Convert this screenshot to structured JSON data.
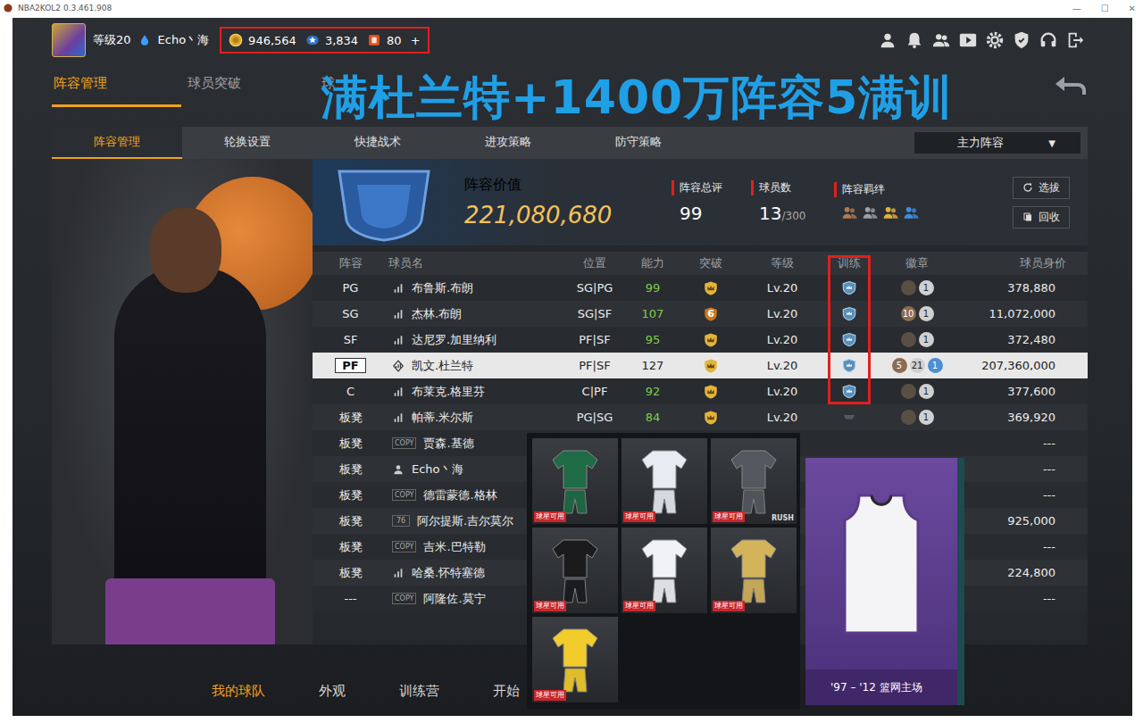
{
  "window": {
    "title": "NBA2KOL2 0.3.461.908",
    "controls": [
      "—",
      "☐",
      "✕"
    ]
  },
  "profile": {
    "level": "等级20",
    "name": "Echo丶海"
  },
  "currency": {
    "boxed": true,
    "items": [
      {
        "kind": "coin",
        "value": "946,564"
      },
      {
        "kind": "star",
        "value": "3,834"
      },
      {
        "kind": "ticket",
        "value": "80"
      }
    ],
    "add": "+"
  },
  "top_tabs": [
    {
      "label": "阵容管理",
      "selected": true
    },
    {
      "label": "球员突破",
      "selected": false
    },
    {
      "label": "球",
      "selected": false
    }
  ],
  "banner": "满杜兰特+1400万阵容5满训",
  "sub_tabs": [
    {
      "label": "阵容管理",
      "selected": true
    },
    {
      "label": "轮换设置",
      "selected": false
    },
    {
      "label": "快捷战术",
      "selected": false
    },
    {
      "label": "进攻策略",
      "selected": false
    },
    {
      "label": "防守策略",
      "selected": false
    }
  ],
  "lineup_select": {
    "value": "主力阵容",
    "arrow": "▼"
  },
  "summary": {
    "value_label": "阵容价值",
    "value": "221,080,680",
    "rating_label": "阵容总评",
    "rating": "99",
    "count_label": "球员数",
    "count": "13",
    "count_max": "/300",
    "bond_label": "阵容羁绊",
    "bonds": [
      {
        "color": "#b07a55"
      },
      {
        "color": "#9aa0a6"
      },
      {
        "color": "#e2b13c"
      },
      {
        "color": "#3d8fe0"
      }
    ],
    "buttons": [
      "选拔",
      "回收"
    ]
  },
  "table": {
    "columns": [
      {
        "label": "阵容",
        "boxed": false
      },
      {
        "label": "球员名",
        "boxed": false
      },
      {
        "label": "位置",
        "boxed": false
      },
      {
        "label": "能力",
        "boxed": false
      },
      {
        "label": "突破",
        "boxed": false
      },
      {
        "label": "等级",
        "boxed": false
      },
      {
        "label": "训练",
        "boxed": true
      },
      {
        "label": "徽章",
        "boxed": false
      },
      {
        "label": "球员身价",
        "boxed": false
      }
    ],
    "rows": [
      {
        "slot": "PG",
        "selected": false,
        "icon": {
          "kind": "bars"
        },
        "name": "布鲁斯.布朗",
        "position": "SG|PG",
        "ability": "99",
        "breakthrough": {
          "kind": "max"
        },
        "level": "Lv.20",
        "trained": true,
        "badges": [
          {
            "text": "",
            "color": "#5a4f45"
          },
          {
            "text": "1",
            "color": "#d0d0d0"
          }
        ],
        "value": "378,880"
      },
      {
        "slot": "SG",
        "selected": false,
        "icon": {
          "kind": "bars"
        },
        "name": "杰林.布朗",
        "position": "SG|SF",
        "ability": "107",
        "breakthrough": {
          "kind": "level",
          "text": "6"
        },
        "level": "Lv.20",
        "trained": true,
        "badges": [
          {
            "text": "10",
            "color": "#8c6b4f"
          },
          {
            "text": "1",
            "color": "#d0d0d0"
          }
        ],
        "value": "11,072,000"
      },
      {
        "slot": "SF",
        "selected": false,
        "icon": {
          "kind": "bars"
        },
        "name": "达尼罗.加里纳利",
        "position": "PF|SF",
        "ability": "95",
        "breakthrough": {
          "kind": "max"
        },
        "level": "Lv.20",
        "trained": true,
        "badges": [
          {
            "text": "",
            "color": "#5a4f45"
          },
          {
            "text": "1",
            "color": "#d0d0d0"
          }
        ],
        "value": "372,480"
      },
      {
        "slot": "PF",
        "selected": true,
        "icon": {
          "kind": "diamond"
        },
        "name": "凯文.杜兰特",
        "position": "PF|SF",
        "ability": "127",
        "breakthrough": {
          "kind": "max"
        },
        "level": "Lv.20",
        "trained": true,
        "badges": [
          {
            "text": "5",
            "color": "#8c6b4f"
          },
          {
            "text": "21",
            "color": "#d0d0d0"
          },
          {
            "text": "1",
            "color": "#4d8fd1"
          }
        ],
        "value": "207,360,000"
      },
      {
        "slot": "C",
        "selected": false,
        "icon": {
          "kind": "bars"
        },
        "name": "布莱克.格里芬",
        "position": "C|PF",
        "ability": "92",
        "breakthrough": {
          "kind": "max"
        },
        "level": "Lv.20",
        "trained": true,
        "badges": [
          {
            "text": "",
            "color": "#5a4f45"
          },
          {
            "text": "1",
            "color": "#d0d0d0"
          }
        ],
        "value": "377,600"
      },
      {
        "slot": "板凳",
        "selected": false,
        "icon": {
          "kind": "bars"
        },
        "name": "帕蒂.米尔斯",
        "position": "PG|SG",
        "ability": "84",
        "breakthrough": {
          "kind": "max"
        },
        "level": "Lv.20",
        "trained": false,
        "badges": [
          {
            "text": "",
            "color": "#5a4f45"
          },
          {
            "text": "1",
            "color": "#d0d0d0"
          }
        ],
        "value": "369,920"
      },
      {
        "slot": "板凳",
        "selected": false,
        "icon": {
          "kind": "tag",
          "text": "COPY"
        },
        "name": "贾森.基德",
        "value": "---"
      },
      {
        "slot": "板凳",
        "selected": false,
        "icon": {
          "kind": "user"
        },
        "name": "Echo丶海",
        "value": "---"
      },
      {
        "slot": "板凳",
        "selected": false,
        "icon": {
          "kind": "tag",
          "text": "COPY"
        },
        "name": "德雷蒙德.格林",
        "value": "---"
      },
      {
        "slot": "板凳",
        "selected": false,
        "icon": {
          "kind": "tag",
          "text": "76"
        },
        "name": "阿尔提斯.吉尔莫尔",
        "value": "925,000"
      },
      {
        "slot": "板凳",
        "selected": false,
        "icon": {
          "kind": "tag",
          "text": "COPY"
        },
        "name": "吉米.巴特勒",
        "value": "---"
      },
      {
        "slot": "板凳",
        "selected": false,
        "icon": {
          "kind": "bars"
        },
        "name": "哈桑.怀特塞德",
        "value": "224,800"
      },
      {
        "slot": "---",
        "selected": false,
        "icon": {
          "kind": "tag",
          "text": "COPY"
        },
        "name": "阿隆佐.莫宁",
        "value": "---"
      }
    ]
  },
  "bottom_nav": [
    {
      "label": "我的球队",
      "selected": true
    },
    {
      "label": "外观",
      "selected": false
    },
    {
      "label": "训练营",
      "selected": false
    },
    {
      "label": "开始",
      "selected": false
    }
  ],
  "outfits": [
    {
      "tag": "球星可用",
      "color": "#1f6b45"
    },
    {
      "tag": "球星可用",
      "color": "#e8ecf2"
    },
    {
      "tag": "球星可用",
      "color": "#55585e",
      "extra": "RUSH"
    },
    {
      "tag": "球星可用",
      "color": "#1b1b1e"
    },
    {
      "tag": "球星可用",
      "color": "#f0f2f6"
    },
    {
      "tag": "球星可用",
      "color": "#d4b45a"
    },
    {
      "tag": "球星可用",
      "color": "#f2cc2a"
    }
  ],
  "jersey_card": {
    "caption": "'97 – '12 篮网主场"
  }
}
